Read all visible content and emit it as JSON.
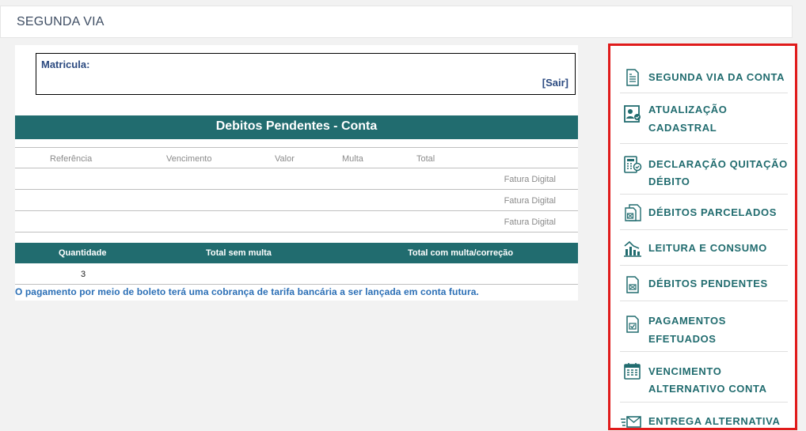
{
  "header": {
    "title": "SEGUNDA VIA"
  },
  "account": {
    "matricula_label": "Matricula:",
    "sair_label": "[Sair]"
  },
  "debitos": {
    "title": "Debitos Pendentes - Conta",
    "columns": [
      "Referência",
      "Vencimento",
      "Valor",
      "Multa",
      "Total"
    ],
    "rows": [
      {
        "status": "Fatura Digital"
      },
      {
        "status": "Fatura Digital"
      },
      {
        "status": "Fatura Digital"
      }
    ]
  },
  "summary": {
    "headers": [
      "Quantidade",
      "Total sem multa",
      "Total com multa/correção"
    ],
    "quantidade": "3"
  },
  "note": "O pagamento por meio de boleto terá uma cobrança de tarifa bancária a ser lançada em conta futura.",
  "menu": {
    "items": [
      {
        "line1": "SEGUNDA VIA DA CONTA",
        "line2": "",
        "icon": "document-icon"
      },
      {
        "line1": "ATUALIZAÇÃO",
        "line2": "CADASTRAL",
        "icon": "profile-update-icon"
      },
      {
        "line1": "DECLARAÇÃO QUITAÇÃO",
        "line2": "DÉBITO",
        "icon": "calculator-check-icon"
      },
      {
        "line1": "DÉBITOS PARCELADOS",
        "line2": "",
        "icon": "installments-icon"
      },
      {
        "line1": "LEITURA E CONSUMO",
        "line2": "",
        "icon": "consumption-chart-icon"
      },
      {
        "line1": "DÉBITOS PENDENTES",
        "line2": "",
        "icon": "pending-bill-icon"
      },
      {
        "line1": "PAGAMENTOS",
        "line2": "EFETUADOS",
        "icon": "payment-check-icon"
      },
      {
        "line1": "VENCIMENTO",
        "line2": "ALTERNATIVO CONTA",
        "icon": "calendar-icon"
      },
      {
        "line1": "ENTREGA ALTERNATIVA",
        "line2": "",
        "icon": "envelope-icon"
      }
    ]
  }
}
